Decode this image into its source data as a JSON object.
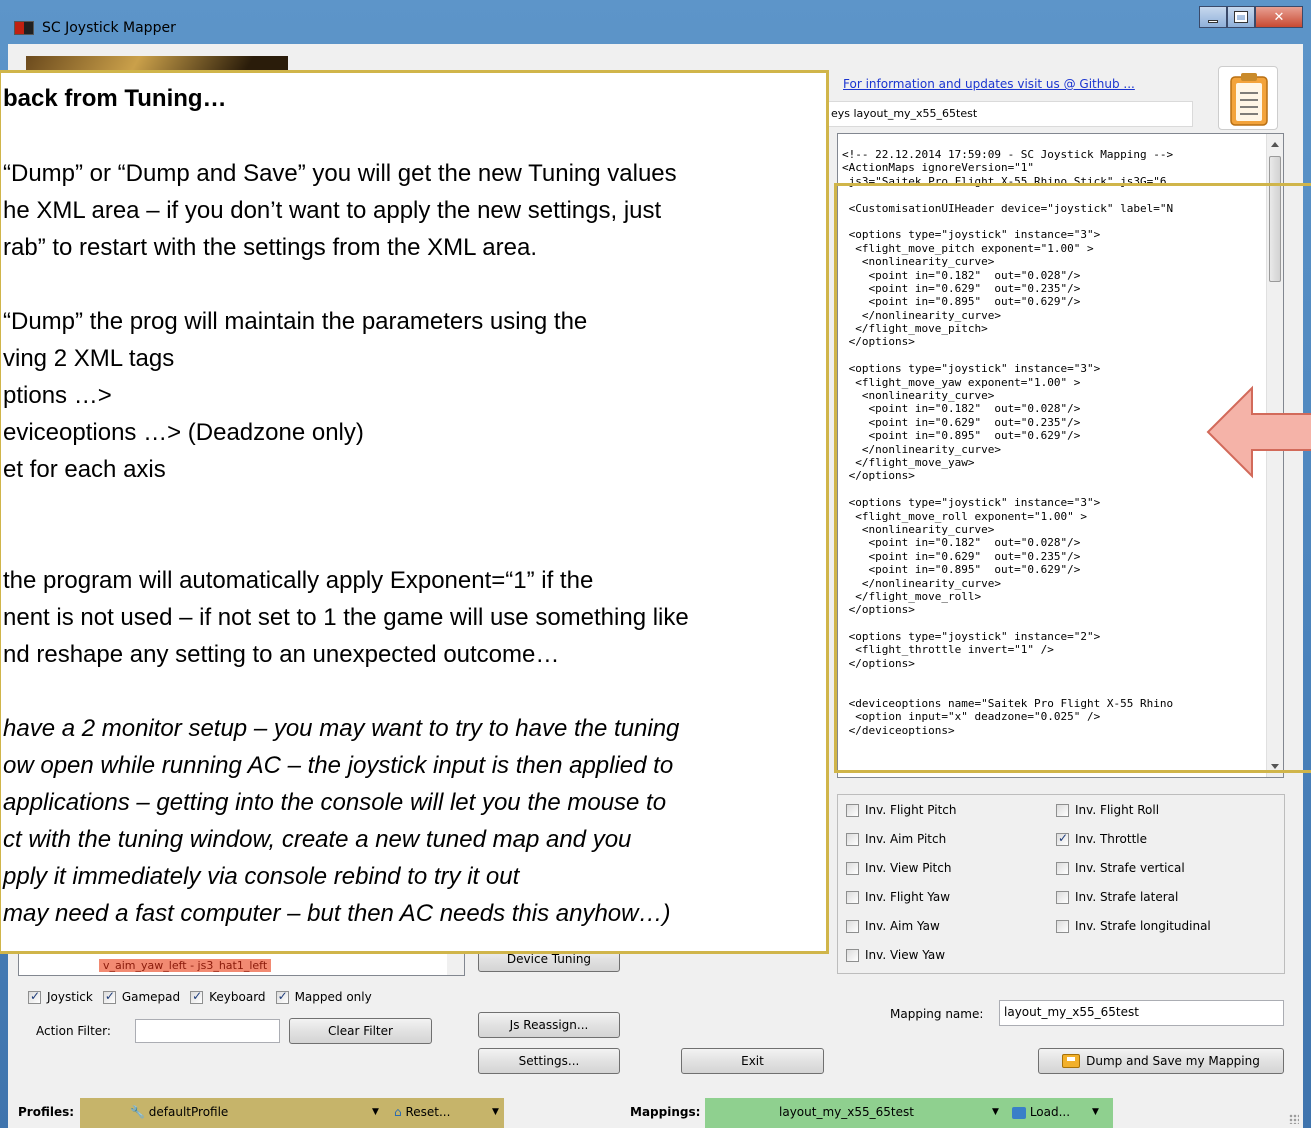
{
  "window": {
    "title": "SC Joystick Mapper",
    "buttons": {
      "minimize": "minimize",
      "maximize": "maximize",
      "close": "close"
    }
  },
  "header": {
    "github_link": "For information and updates visit us @ Github ...",
    "path_field_value": "eys layout_my_x55_65test"
  },
  "xml": {
    "lines": [
      "<!-- 22.12.2014 17:59:09 - SC Joystick Mapping -->",
      "<ActionMaps ignoreVersion=\"1\"",
      " js3=\"Saitek Pro Flight X-55 Rhino Stick\" js3G=\"6",
      "",
      " <CustomisationUIHeader device=\"joystick\" label=\"N",
      "",
      " <options type=\"joystick\" instance=\"3\">",
      "  <flight_move_pitch exponent=\"1.00\" >",
      "   <nonlinearity_curve>",
      "    <point in=\"0.182\"  out=\"0.028\"/>",
      "    <point in=\"0.629\"  out=\"0.235\"/>",
      "    <point in=\"0.895\"  out=\"0.629\"/>",
      "   </nonlinearity_curve>",
      "  </flight_move_pitch>",
      " </options>",
      "",
      " <options type=\"joystick\" instance=\"3\">",
      "  <flight_move_yaw exponent=\"1.00\" >",
      "   <nonlinearity_curve>",
      "    <point in=\"0.182\"  out=\"0.028\"/>",
      "    <point in=\"0.629\"  out=\"0.235\"/>",
      "    <point in=\"0.895\"  out=\"0.629\"/>",
      "   </nonlinearity_curve>",
      "  </flight_move_yaw>",
      " </options>",
      "",
      " <options type=\"joystick\" instance=\"3\">",
      "  <flight_move_roll exponent=\"1.00\" >",
      "   <nonlinearity_curve>",
      "    <point in=\"0.182\"  out=\"0.028\"/>",
      "    <point in=\"0.629\"  out=\"0.235\"/>",
      "    <point in=\"0.895\"  out=\"0.629\"/>",
      "   </nonlinearity_curve>",
      "  </flight_move_roll>",
      " </options>",
      "",
      " <options type=\"joystick\" instance=\"2\">",
      "  <flight_throttle invert=\"1\" />",
      " </options>",
      "",
      "",
      " <deviceoptions name=\"Saitek Pro Flight X-55 Rhino",
      "  <option input=\"x\" deadzone=\"0.025\" />",
      " </deviceoptions>"
    ]
  },
  "invert": {
    "left": [
      {
        "label": "Inv. Flight Pitch",
        "checked": false
      },
      {
        "label": "Inv. Aim Pitch",
        "checked": false
      },
      {
        "label": "Inv. View Pitch",
        "checked": false
      },
      {
        "label": "Inv. Flight Yaw",
        "checked": false
      },
      {
        "label": "Inv. Aim Yaw",
        "checked": false
      },
      {
        "label": "Inv. View Yaw",
        "checked": false
      }
    ],
    "right": [
      {
        "label": "Inv. Flight Roll",
        "checked": false
      },
      {
        "label": "Inv. Throttle",
        "checked": true
      },
      {
        "label": "Inv. Strafe vertical",
        "checked": false
      },
      {
        "label": "Inv. Strafe lateral",
        "checked": false
      },
      {
        "label": "Inv. Strafe longitudinal",
        "checked": false
      }
    ]
  },
  "tree": {
    "selected_row": "v_aim_yaw_left - js3_hat1_left"
  },
  "filters": {
    "checks": [
      {
        "label": "Joystick",
        "checked": true
      },
      {
        "label": "Gamepad",
        "checked": true
      },
      {
        "label": "Keyboard",
        "checked": true
      },
      {
        "label": "Mapped only",
        "checked": true
      }
    ],
    "action_filter_label": "Action Filter:",
    "action_filter_value": "",
    "clear_filter": "Clear Filter"
  },
  "buttons": {
    "device_tuning": "Device Tuning",
    "js_reassign": "Js Reassign...",
    "settings": "Settings...",
    "exit": "Exit",
    "dump_save": "Dump and Save my Mapping"
  },
  "mapping": {
    "name_label": "Mapping name:",
    "name_value": "layout_my_x55_65test"
  },
  "status": {
    "profiles_label": "Profiles:",
    "profile_value": "defaultProfile",
    "reset": "Reset...",
    "mappings_label": "Mappings:",
    "mapping_value": "layout_my_x55_65test",
    "load": "Load..."
  },
  "overlay": {
    "lines": [
      {
        "text": "back from Tuning…",
        "style": "title"
      },
      {
        "text": "“Dump” or “Dump and Save” you will get the new Tuning values",
        "style": "normal"
      },
      {
        "text": "he XML area – if you don’t want to apply the new settings, just",
        "style": "normal"
      },
      {
        "text": "rab” to restart with the settings from the XML area.",
        "style": "normal"
      },
      {
        "text": "",
        "style": "normal"
      },
      {
        "text": "“Dump” the prog will maintain the parameters using the",
        "style": "normal"
      },
      {
        "text": "ving 2 XML tags",
        "style": "normal"
      },
      {
        "text": "ptions …>",
        "style": "normal"
      },
      {
        "text": "eviceoptions …>  (Deadzone only)",
        "style": "normal"
      },
      {
        "text": "et for each axis",
        "style": "normal"
      },
      {
        "text": "",
        "style": "normal"
      },
      {
        "text": "",
        "style": "normal"
      },
      {
        "text": " the program will automatically apply Exponent=“1”  if the",
        "style": "normal"
      },
      {
        "text": "nent is not used – if not set to 1 the game will use something like",
        "style": "normal"
      },
      {
        "text": "nd reshape any setting to an unexpected outcome…",
        "style": "normal"
      },
      {
        "text": "",
        "style": "normal"
      },
      {
        "text": " have a 2 monitor setup – you may want to try to have the tuning",
        "style": "italic"
      },
      {
        "text": "ow open while running AC – the joystick input is then applied to",
        "style": "italic"
      },
      {
        "text": "applications – getting into the console will let you the mouse to",
        "style": "italic"
      },
      {
        "text": "ct with the tuning window, create a new tuned map and you",
        "style": "italic"
      },
      {
        "text": "pply it immediately via console rebind to try it out",
        "style": "italic"
      },
      {
        "text": "may need a fast computer – but then AC needs this anyhow…)",
        "style": "italic"
      }
    ]
  },
  "colors": {
    "callout_border": "#d0b54a",
    "arrow_fill": "#f5b3a8",
    "profiles_bg": "#c6b46a",
    "mappings_bg": "#8fd08f",
    "link": "#1b35d0"
  }
}
